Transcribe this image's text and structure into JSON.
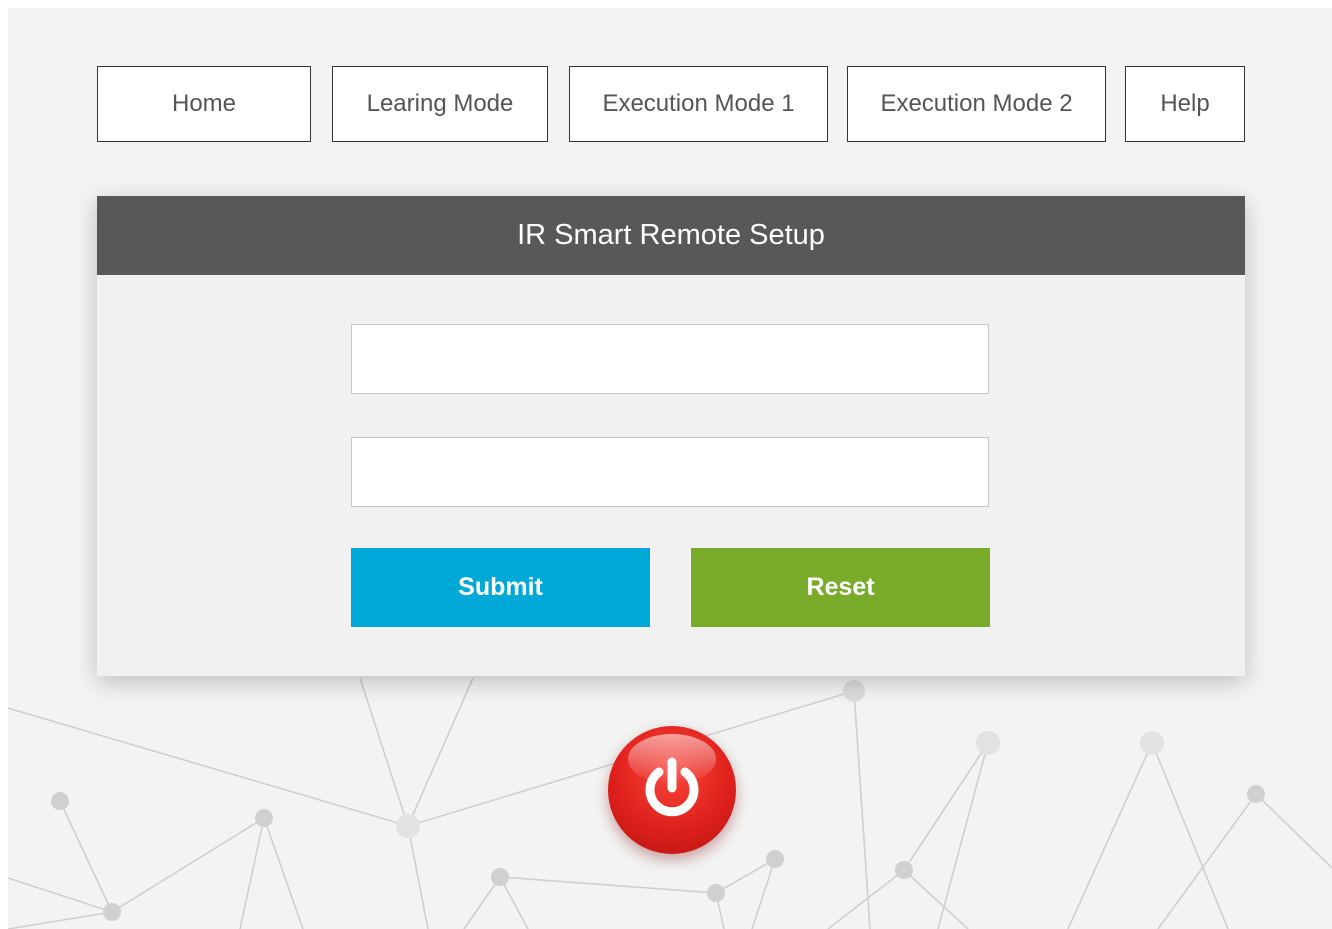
{
  "nav": {
    "items": [
      {
        "label": "Home"
      },
      {
        "label": "Learing Mode"
      },
      {
        "label": "Execution Mode 1"
      },
      {
        "label": "Execution Mode 2"
      },
      {
        "label": "Help"
      }
    ]
  },
  "panel": {
    "title": "IR Smart Remote Setup",
    "field1": {
      "value": "",
      "placeholder": ""
    },
    "field2": {
      "value": "",
      "placeholder": ""
    },
    "submit_label": "Submit",
    "reset_label": "Reset"
  },
  "power": {
    "icon": "power-icon"
  },
  "colors": {
    "header": "#58585a",
    "submit": "#00a8d8",
    "reset": "#79ab2a",
    "power": "#e0201c",
    "background": "#f3f3f3"
  }
}
